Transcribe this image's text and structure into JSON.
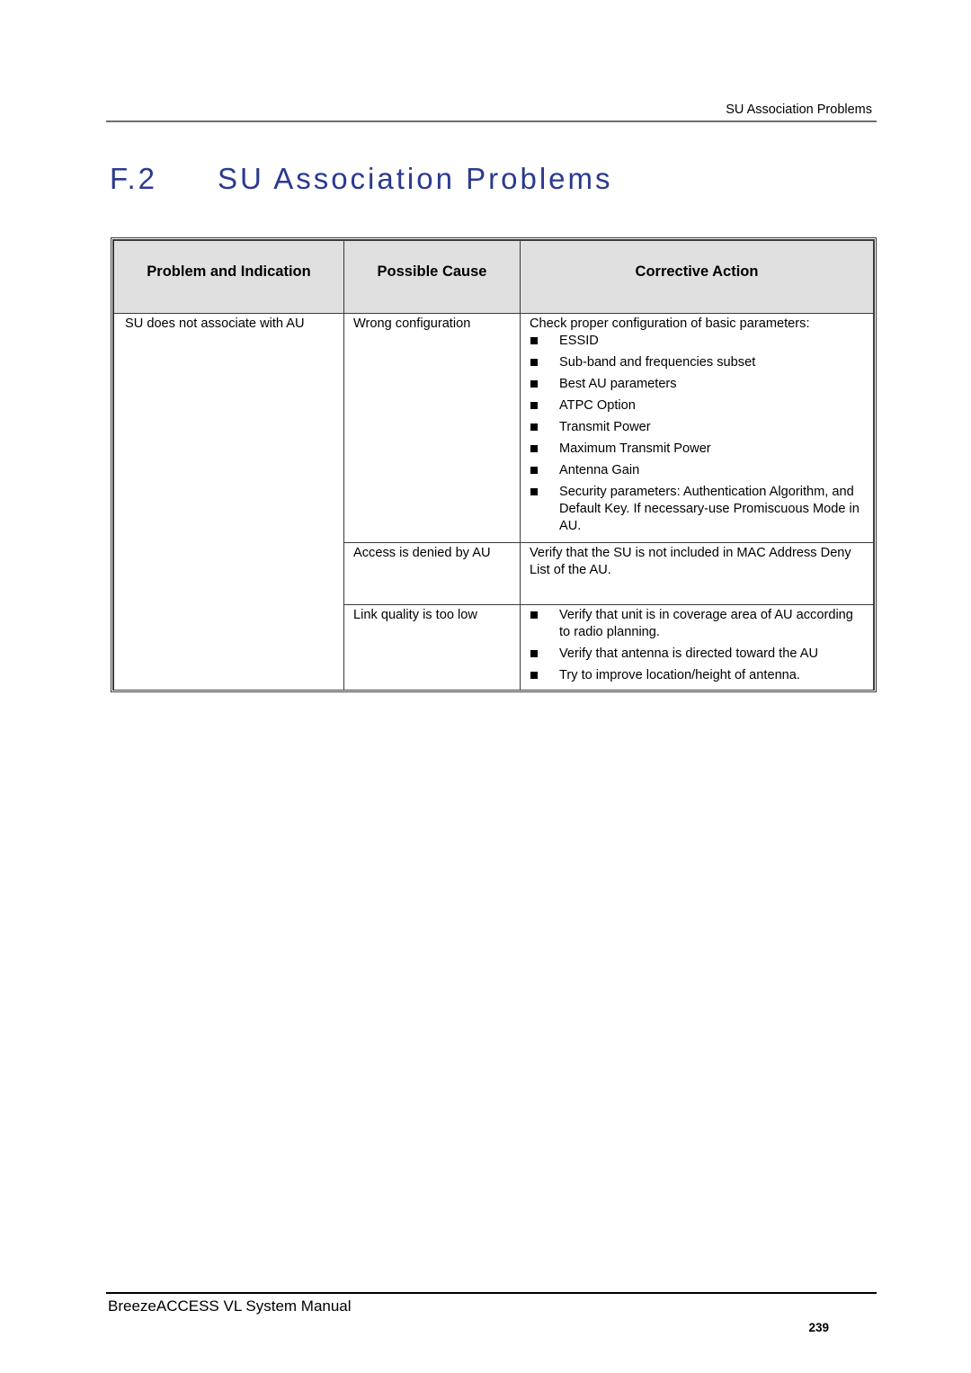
{
  "header": {
    "running_title": "SU Association Problems"
  },
  "section": {
    "number": "F.2",
    "title": "SU Association Problems",
    "title_color": "#2b3a8e"
  },
  "table": {
    "columns": [
      "Problem and Indication",
      "Possible Cause",
      "Corrective Action"
    ],
    "header_bg": "#e0e0e0",
    "rows": [
      {
        "problem": "SU does not associate with AU",
        "cause": "Wrong configuration",
        "action_intro": "Check proper configuration of basic parameters:",
        "action_bullets": [
          "ESSID",
          "Sub-band and frequencies subset",
          "Best AU parameters",
          "ATPC Option",
          "Transmit Power",
          "Maximum Transmit Power",
          "Antenna Gain",
          "Security parameters: Authentication Algorithm, and Default Key. If necessary-use Promiscuous Mode in AU."
        ]
      },
      {
        "problem": "",
        "cause": "Access is denied by AU",
        "action_intro": "Verify that the SU is not included in MAC Address Deny List of the AU.",
        "action_bullets": []
      },
      {
        "problem": "",
        "cause": "Link quality is too low",
        "action_intro": "",
        "action_bullets": [
          "Verify that unit is in coverage area of AU according to radio planning.",
          "Verify that antenna is directed toward the AU",
          "Try to improve location/height of antenna."
        ]
      }
    ]
  },
  "footer": {
    "manual_title": "BreezeACCESS VL System Manual",
    "page_number": "239"
  }
}
